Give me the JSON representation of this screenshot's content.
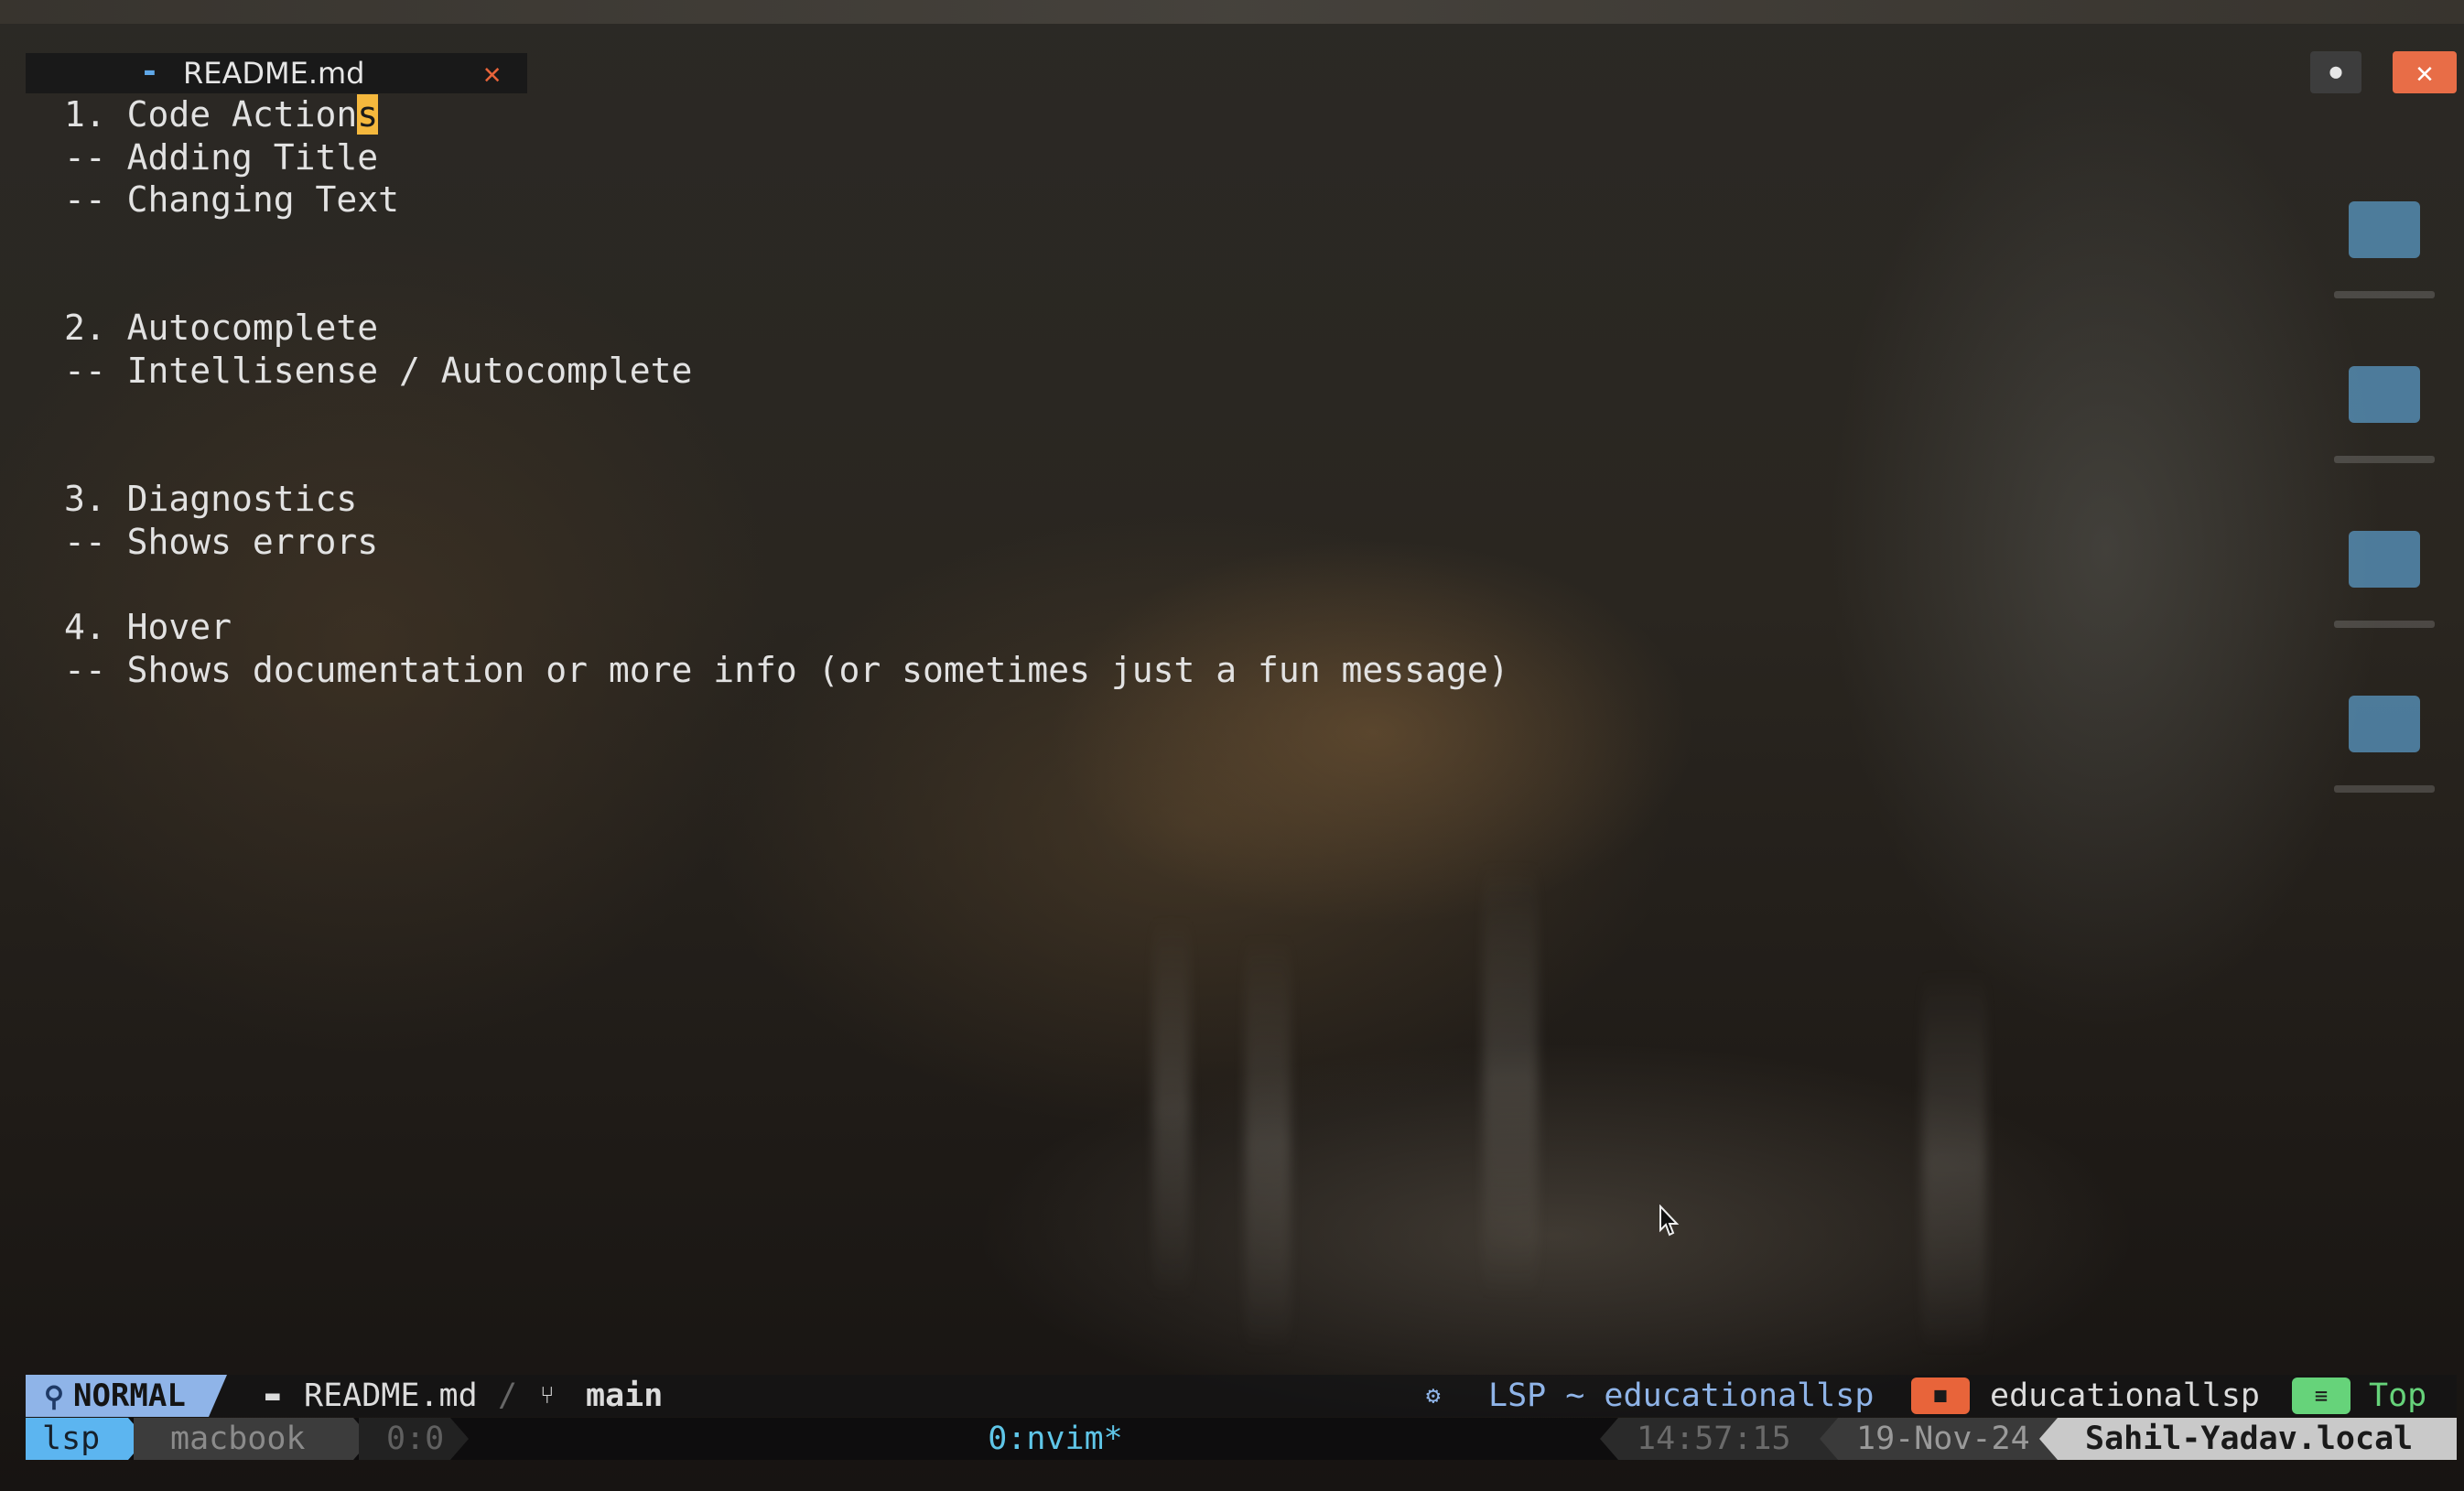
{
  "tab": {
    "icon": "markdown-icon",
    "title": "README.md",
    "close_icon": "close-icon"
  },
  "window_controls": {
    "preview_icon": "eye-icon",
    "close_icon": "close-icon"
  },
  "buffer": {
    "lines": [
      "1. Code Actions",
      "-- Adding Title",
      "-- Changing Text",
      "",
      "",
      "2. Autocomplete",
      "-- Intellisense / Autocomplete",
      "",
      "",
      "3. Diagnostics",
      "-- Shows errors",
      "",
      "4. Hover",
      "-- Shows documentation or more info (or sometimes just a fun message)"
    ],
    "cursor": {
      "line": 0,
      "column": 14
    }
  },
  "statusline": {
    "mode": "NORMAL",
    "mode_icon": "vim-icon",
    "file_icon": "markdown-icon",
    "file": "README.md",
    "branch_icon": "git-branch-icon",
    "branch": "main",
    "lsp_icon": "lsp-gear-icon",
    "lsp": "LSP ~ educationallsp",
    "folder_icon": "folder-icon",
    "project": "educationallsp",
    "position_icon": "lines-icon",
    "position": "Top"
  },
  "tmux": {
    "session": "lsp",
    "host": "macbook",
    "pane": "0:0",
    "window": "0:nvim*",
    "time": "14:57:15",
    "date": "19-Nov-24",
    "user_host": "Sahil-Yadav.local"
  },
  "colors": {
    "mode_bg": "#8fb4e8",
    "cursor": "#f5b83d",
    "close_accent": "#e86d47",
    "session_bg": "#5cb5f0",
    "lines_badge": "#66d37a"
  }
}
